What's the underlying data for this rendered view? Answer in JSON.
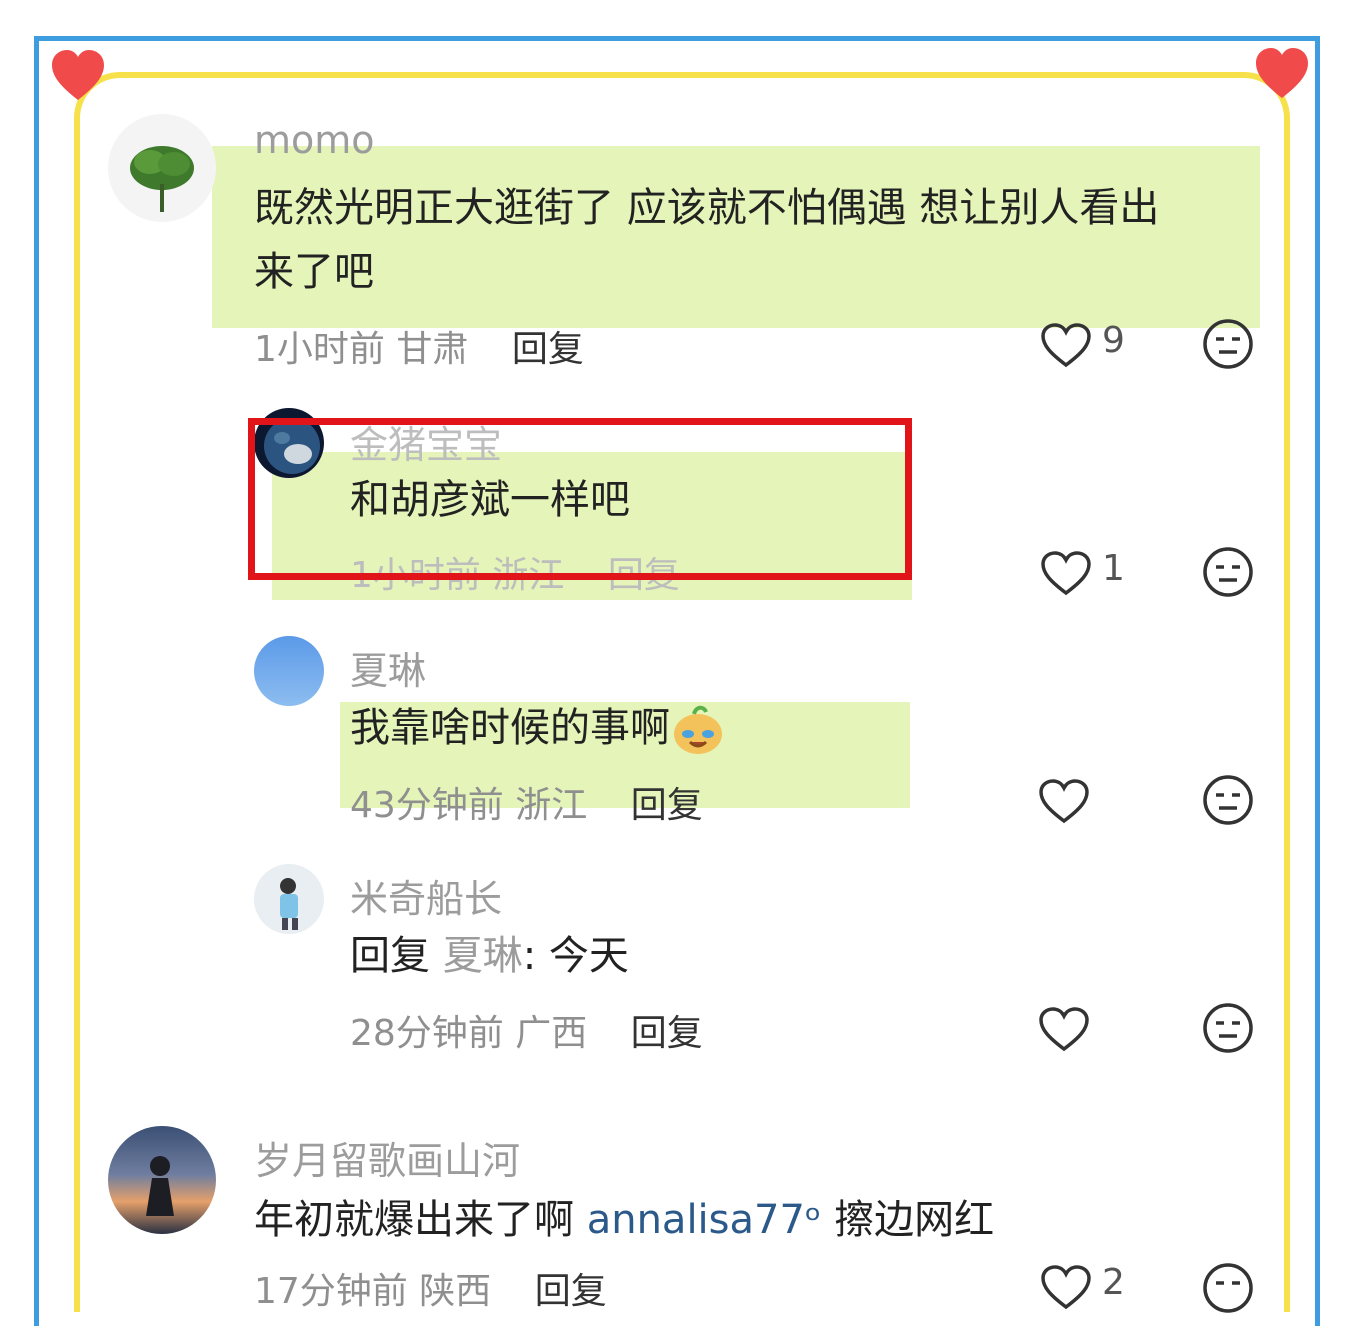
{
  "comments": [
    {
      "user": "momo",
      "text_line1": "既然光明正大逛街了 应该就不怕偶遇 想让别人看出",
      "text_line2": "来了吧",
      "time": "1小时前",
      "location": "甘肃",
      "reply": "回复",
      "likes": "9"
    },
    {
      "user": "金猪宝宝",
      "text": "和胡彦斌一样吧",
      "time": "1小时前",
      "location": "浙江",
      "reply": "回复",
      "likes": "1"
    },
    {
      "user": "夏琳",
      "text": "我靠啥时候的事啊",
      "time": "43分钟前",
      "location": "浙江",
      "reply": "回复",
      "likes": ""
    },
    {
      "user": "米奇船长",
      "reply_prefix": "回复",
      "reply_target": "夏琳",
      "text": ": 今天",
      "time": "28分钟前",
      "location": "广西",
      "reply": "回复",
      "likes": ""
    },
    {
      "user": "岁月留歌画山河",
      "text_a": "年初就爆出来了啊",
      "mention": "annalisa77ᵒ",
      "text_b": "擦边网红",
      "time": "17分钟前",
      "location": "陕西",
      "reply": "回复",
      "likes": "2"
    }
  ],
  "colors": {
    "border_blue": "#3d9ddf",
    "border_yellow": "#f7e14a",
    "highlight": "#e5f5b9",
    "red_box": "#e01419",
    "heart": "#f04a4a"
  },
  "icons": [
    "heart-icon",
    "like-icon",
    "dislike-face-icon",
    "avatar"
  ]
}
